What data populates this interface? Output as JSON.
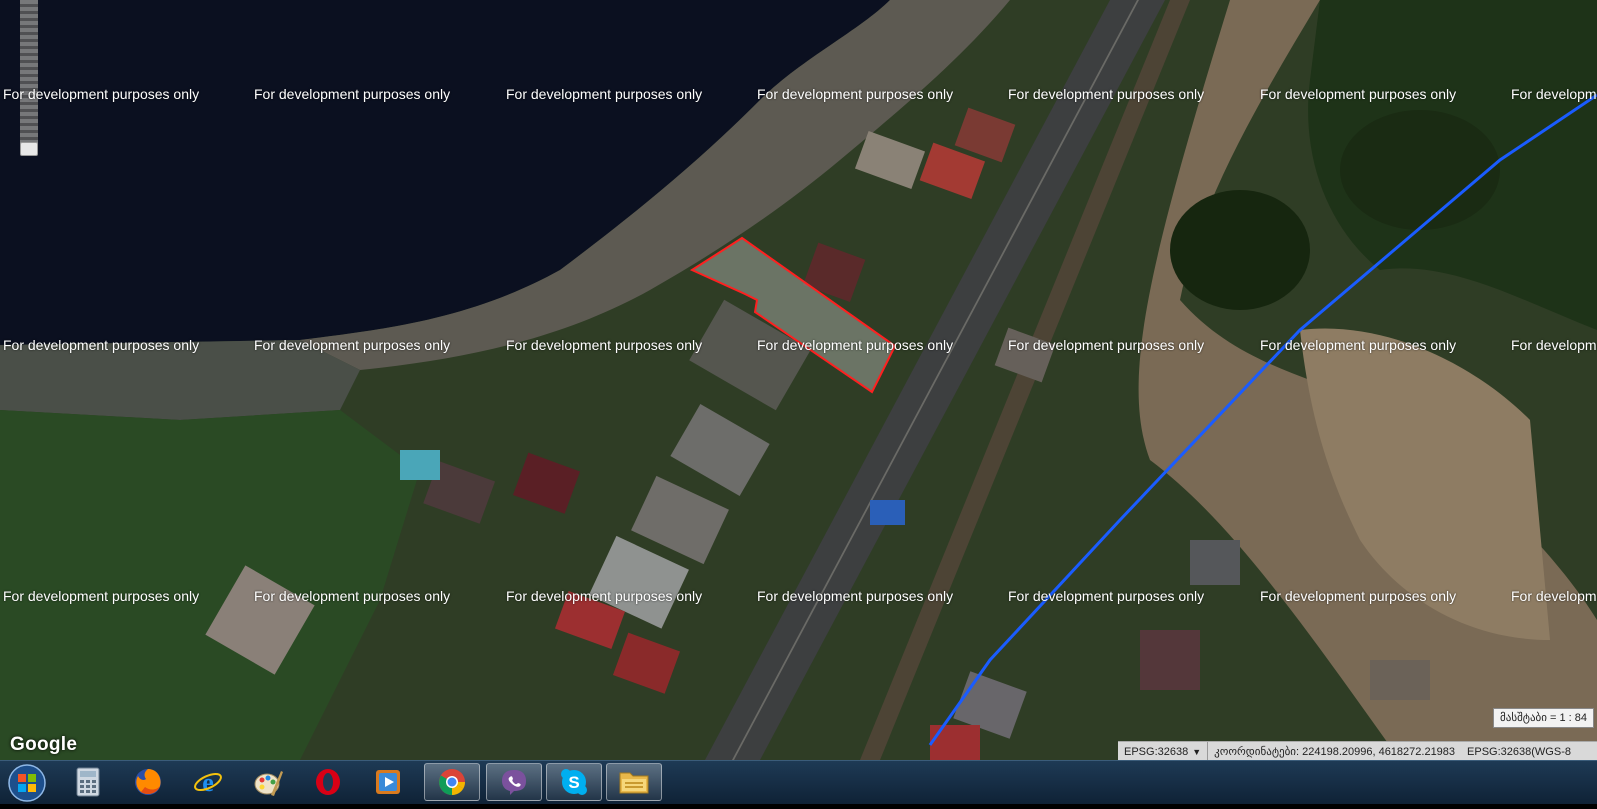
{
  "map": {
    "watermark_text": "For development purposes only",
    "google_logo": "Google",
    "zoom_level_fraction": 1.0
  },
  "scale": {
    "label": "მასშტაბი = 1 : 84"
  },
  "statusbar": {
    "projection": "EPSG:32638",
    "dropdown_arrow": "▼",
    "coordinates_label": "კოორდინატები: 224198.20996, 4618272.21983",
    "projection_full": "EPSG:32638(WGS-8"
  },
  "taskbar": {
    "items": [
      {
        "name": "start-orb-icon"
      },
      {
        "name": "calculator-icon"
      },
      {
        "name": "firefox-icon"
      },
      {
        "name": "internet-explorer-icon"
      },
      {
        "name": "paint-icon"
      },
      {
        "name": "opera-icon"
      },
      {
        "name": "media-player-icon"
      },
      {
        "name": "chrome-icon"
      },
      {
        "name": "viber-icon"
      },
      {
        "name": "skype-icon"
      },
      {
        "name": "file-explorer-icon"
      }
    ]
  },
  "colors": {
    "parcel_outline": "#ff2020",
    "boundary_line": "#1a5cff",
    "sea": "#0b1020"
  }
}
